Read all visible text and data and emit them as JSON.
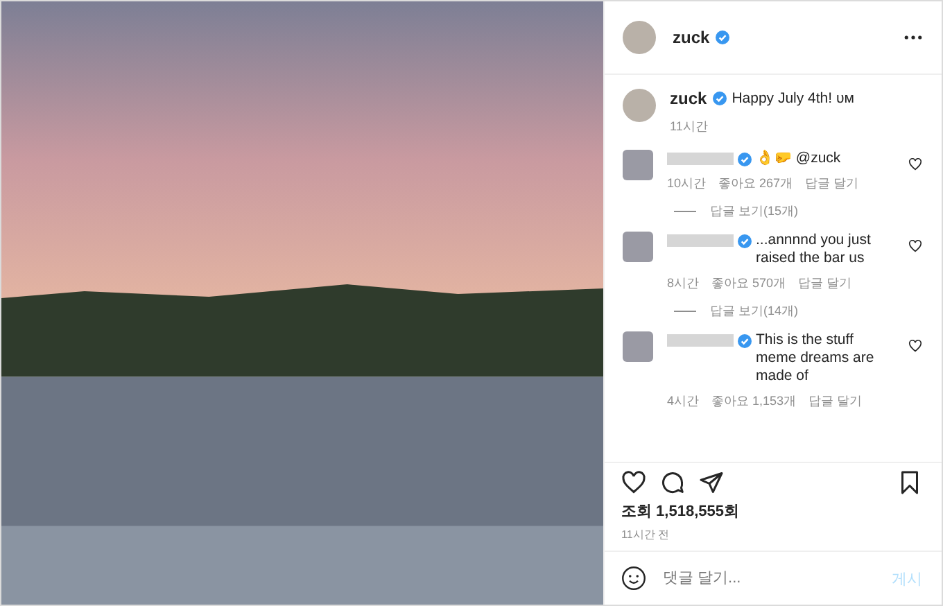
{
  "post_header": {
    "username": "zuck",
    "verified": true
  },
  "caption": {
    "username": "zuck",
    "verified": true,
    "text": "Happy July 4th! ᴜᴍ",
    "time": "11시간"
  },
  "comments": [
    {
      "verified": true,
      "text": "👌🤛 @zuck",
      "time": "10시간",
      "likes": "좋아요 267개",
      "reply": "답글 달기",
      "view_replies": "답글 보기(15개)"
    },
    {
      "verified": true,
      "text": "...annnnd you just raised the bar us",
      "time": "8시간",
      "likes": "좋아요 570개",
      "reply": "답글 달기",
      "view_replies": "답글 보기(14개)"
    },
    {
      "verified": true,
      "text": "This is the stuff meme dreams are made of",
      "time": "4시간",
      "likes": "좋아요 1,153개",
      "reply": "답글 달기"
    }
  ],
  "views": "조회 1,518,555회",
  "posted": "11시간 전",
  "comment_box": {
    "placeholder": "댓글 달기..."
  },
  "post_button": {
    "label": "게시",
    "disabled": true
  }
}
